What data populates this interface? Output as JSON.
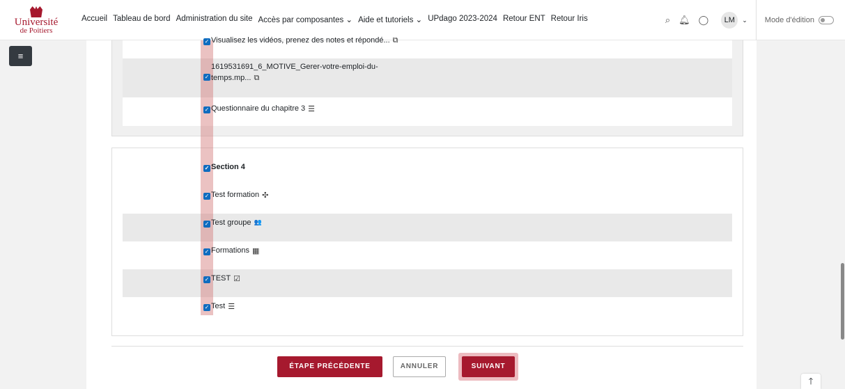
{
  "logo": {
    "univ": "Université",
    "poitiers": "de Poitiers"
  },
  "nav": {
    "links": [
      "Accueil",
      "Tableau de bord",
      "Administration du site",
      "Accès par composantes ⌄",
      "Aide et tutoriels ⌄",
      "UPdago 2023-2024",
      "Retour ENT",
      "Retour Iris"
    ],
    "user_initials": "LM",
    "edit_mode_label": "Mode d'édition"
  },
  "section3": {
    "items": [
      {
        "label": "Visualisez les vidéos, prenez des notes et répondé...",
        "icon": "video-icon",
        "glyph": "⧉"
      },
      {
        "label": "1619531691_6_MOTIVE_Gerer-votre-emploi-du-",
        "label2": "temps.mp...",
        "icon": "video-icon",
        "glyph": "⧉"
      },
      {
        "label": "Questionnaire du chapitre 3",
        "icon": "quiz-icon",
        "glyph": "☰"
      }
    ]
  },
  "section4": {
    "title": "Section 4",
    "items": [
      {
        "label": "Test formation",
        "icon": "puzzle-icon",
        "glyph": "✣"
      },
      {
        "label": "Test groupe",
        "icon": "group-icon",
        "glyph": "👥"
      },
      {
        "label": "Formations",
        "icon": "workshop-icon",
        "glyph": "▦"
      },
      {
        "label": "TEST",
        "icon": "assignment-icon",
        "glyph": "☑"
      },
      {
        "label": "Test",
        "icon": "quiz-icon",
        "glyph": "☰"
      }
    ]
  },
  "buttons": {
    "previous": "ÉTAPE PRÉCÉDENTE",
    "cancel": "ANNULER",
    "next": "SUIVANT"
  },
  "colors": {
    "brand": "#a6192e",
    "checkbox": "#0f6cbf"
  }
}
